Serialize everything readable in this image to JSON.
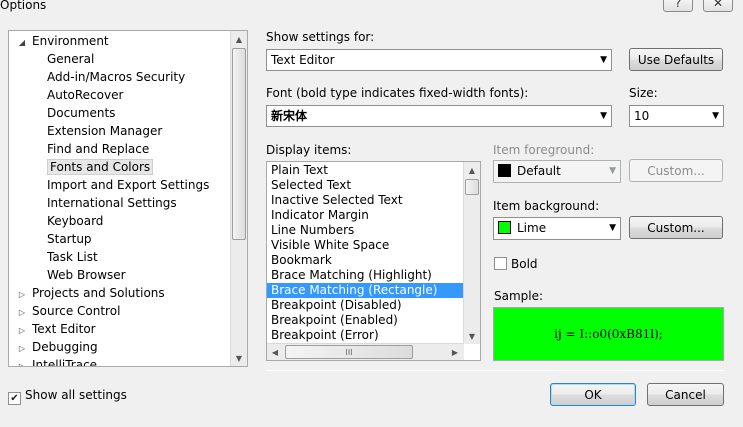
{
  "window": {
    "title": "Options",
    "help_glyph": "?",
    "close_glyph": "✕"
  },
  "tree": {
    "items": [
      {
        "label": "Environment",
        "level": 0,
        "expander": "◢"
      },
      {
        "label": "General",
        "level": 1
      },
      {
        "label": "Add-in/Macros Security",
        "level": 1
      },
      {
        "label": "AutoRecover",
        "level": 1
      },
      {
        "label": "Documents",
        "level": 1
      },
      {
        "label": "Extension Manager",
        "level": 1
      },
      {
        "label": "Find and Replace",
        "level": 1
      },
      {
        "label": "Fonts and Colors",
        "level": 1,
        "selected": true
      },
      {
        "label": "Import and Export Settings",
        "level": 1
      },
      {
        "label": "International Settings",
        "level": 1
      },
      {
        "label": "Keyboard",
        "level": 1
      },
      {
        "label": "Startup",
        "level": 1
      },
      {
        "label": "Task List",
        "level": 1
      },
      {
        "label": "Web Browser",
        "level": 1
      },
      {
        "label": "Projects and Solutions",
        "level": 0,
        "expander": "▷"
      },
      {
        "label": "Source Control",
        "level": 0,
        "expander": "▷"
      },
      {
        "label": "Text Editor",
        "level": 0,
        "expander": "▷"
      },
      {
        "label": "Debugging",
        "level": 0,
        "expander": "▷"
      },
      {
        "label": "IntelliTrace",
        "level": 0,
        "expander": "▷"
      }
    ]
  },
  "show_settings": {
    "label": "Show settings for:",
    "value": "Text Editor",
    "use_defaults": "Use Defaults"
  },
  "font": {
    "label": "Font (bold type indicates fixed-width fonts):",
    "value": "新宋体"
  },
  "size": {
    "label": "Size:",
    "value": "10"
  },
  "display_items": {
    "label": "Display items:",
    "items": [
      {
        "label": "Plain Text"
      },
      {
        "label": "Selected Text"
      },
      {
        "label": "Inactive Selected Text"
      },
      {
        "label": "Indicator Margin"
      },
      {
        "label": "Line Numbers"
      },
      {
        "label": "Visible White Space"
      },
      {
        "label": "Bookmark"
      },
      {
        "label": "Brace Matching (Highlight)"
      },
      {
        "label": "Brace Matching (Rectangle)",
        "selected": true
      },
      {
        "label": "Breakpoint (Disabled)"
      },
      {
        "label": "Breakpoint (Enabled)"
      },
      {
        "label": "Breakpoint (Error)"
      }
    ],
    "hscroll_grip": "III"
  },
  "item_foreground": {
    "label": "Item foreground:",
    "value": "Default",
    "color": "#000000",
    "custom": "Custom..."
  },
  "item_background": {
    "label": "Item background:",
    "value": "Lime",
    "color": "#00ff00",
    "custom": "Custom..."
  },
  "bold": {
    "label": "Bold",
    "checked": false
  },
  "sample": {
    "label": "Sample:",
    "text": "ij = I::o0(0xB81l);",
    "background": "#00ff00"
  },
  "footer": {
    "show_all": "Show all settings",
    "show_all_checked": true,
    "ok": "OK",
    "cancel": "Cancel"
  }
}
